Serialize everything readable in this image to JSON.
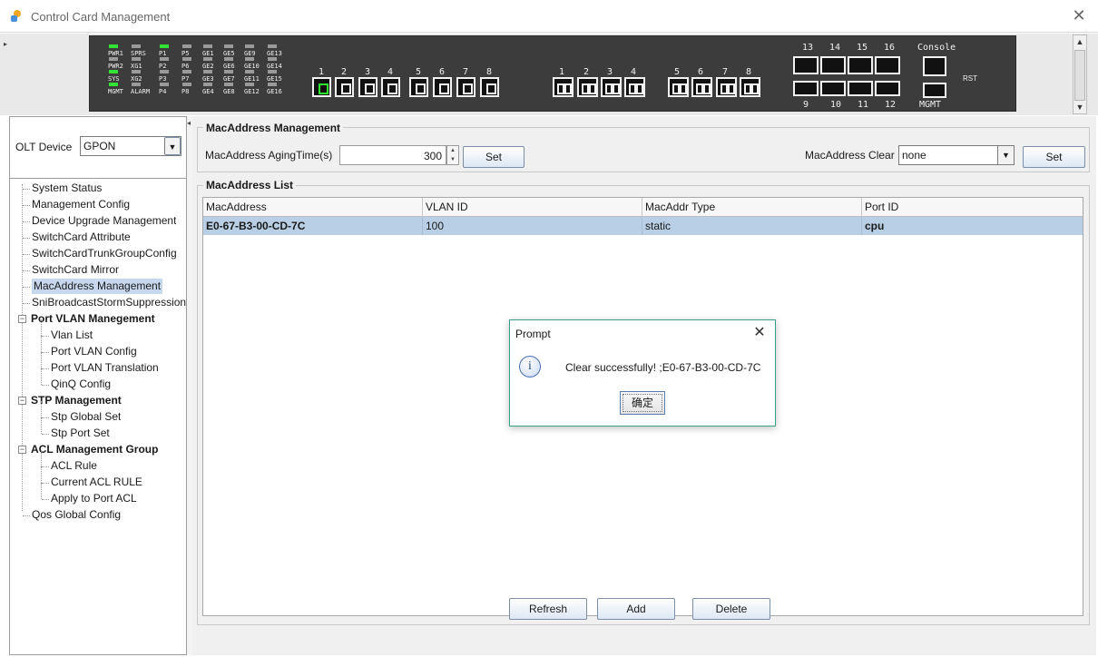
{
  "window": {
    "title": "Control Card Management",
    "close_glyph": "✕"
  },
  "device_panel": {
    "led_groups": [
      [
        "PWR1",
        "SPRS",
        "P1",
        "P5"
      ],
      [
        "PWR2",
        "XG1",
        "P2",
        "P6"
      ],
      [
        "SYS",
        "XG2",
        "P3",
        "P7"
      ],
      [
        "MGMT",
        "ALARM",
        "P4",
        "P8"
      ]
    ],
    "ge_labels": [
      [
        "GE1",
        "GE5",
        "GE9",
        "GE13"
      ],
      [
        "GE2",
        "GE6",
        "GE10",
        "GE14"
      ],
      [
        "GE3",
        "GE7",
        "GE11",
        "GE15"
      ],
      [
        "GE4",
        "GE8",
        "GE12",
        "GE16"
      ]
    ],
    "sfp_ports": [
      "1",
      "2",
      "3",
      "4",
      "5",
      "6",
      "7",
      "8"
    ],
    "pon_ports": [
      "1",
      "2",
      "3",
      "4",
      "5",
      "6",
      "7",
      "8"
    ],
    "top_rj_ports": [
      "13",
      "14",
      "15",
      "16"
    ],
    "bottom_rj_ports": [
      "9",
      "10",
      "11",
      "12"
    ],
    "console_label": "Console",
    "mgmt_label": "MGMT",
    "rst_label": "RST",
    "led_on_color": "#34e234"
  },
  "sidebar": {
    "olt_label": "OLT Device",
    "olt_value": "GPON",
    "items": [
      {
        "label": "System Status"
      },
      {
        "label": "Management Config"
      },
      {
        "label": "Device Upgrade Management"
      },
      {
        "label": "SwitchCard Attribute"
      },
      {
        "label": "SwitchCardTrunkGroupConfig"
      },
      {
        "label": "SwitchCard Mirror"
      },
      {
        "label": "MacAddress Management"
      },
      {
        "label": "SniBroadcastStormSuppression"
      },
      {
        "label": "Port VLAN Manegement"
      },
      {
        "label": "Vlan List"
      },
      {
        "label": "Port VLAN Config"
      },
      {
        "label": "Port VLAN Translation"
      },
      {
        "label": "QinQ Config"
      },
      {
        "label": "STP Management"
      },
      {
        "label": "Stp Global Set"
      },
      {
        "label": "Stp Port Set"
      },
      {
        "label": "ACL Management Group"
      },
      {
        "label": "ACL Rule"
      },
      {
        "label": "Current ACL RULE"
      },
      {
        "label": "Apply to Port ACL"
      },
      {
        "label": "Qos Global Config"
      }
    ],
    "toggle_glyph": "−"
  },
  "mac_mgmt": {
    "legend": "MacAddress Management",
    "aging_label": "MacAddress AgingTime(s)",
    "aging_value": "300",
    "set_label": "Set",
    "clear_label": "MacAddress Clear",
    "clear_value": "none",
    "clear_set_label": "Set"
  },
  "mac_list": {
    "legend": "MacAddress List",
    "columns": [
      "MacAddress",
      "VLAN ID",
      "MacAddr Type",
      "Port ID"
    ],
    "rows": [
      [
        "E0-67-B3-00-CD-7C",
        "100",
        "static",
        "cpu"
      ]
    ]
  },
  "actions": {
    "refresh": "Refresh",
    "add": "Add",
    "delete": "Delete"
  },
  "dialog": {
    "title": "Prompt",
    "message": "Clear successfully! ;E0-67-B3-00-CD-7C",
    "ok": "确定",
    "close_glyph": "✕",
    "info_glyph": "i"
  }
}
